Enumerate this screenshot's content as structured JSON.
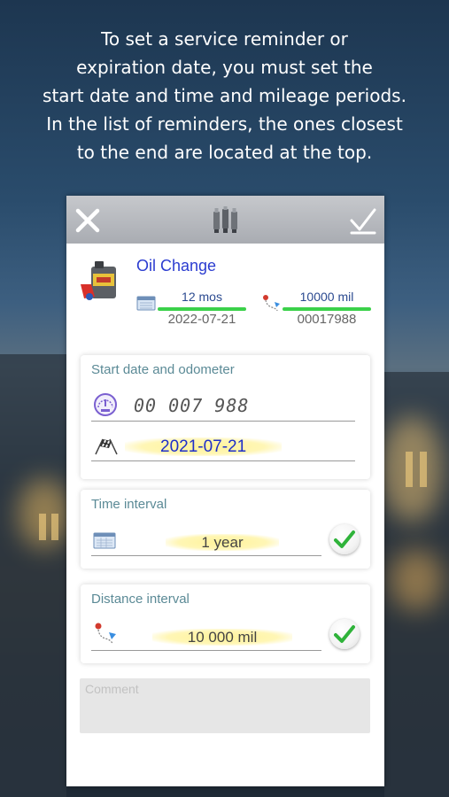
{
  "headline": {
    "line1": "To set a service reminder or",
    "line2": "expiration date, you must set the",
    "line3": "start date and time and mileage periods.",
    "line4": "In the list of reminders, the ones closest",
    "line5": "to the end are located at the top."
  },
  "toolbar": {
    "close_icon": "close-icon",
    "center_icon": "spark-plugs-icon",
    "ok_icon": "checkmark-icon"
  },
  "reminder": {
    "title": "Oil Change",
    "time_interval_short": "12 mos",
    "expiry_date": "2022-07-21",
    "distance_interval_short": "10000 mil",
    "expiry_odometer": "00017988"
  },
  "start_card": {
    "label": "Start date and odometer",
    "odometer": "00 007 988",
    "date": "2021-07-21"
  },
  "time_card": {
    "label": "Time interval",
    "value": "1 year",
    "enabled": true
  },
  "distance_card": {
    "label": "Distance interval",
    "value": "10 000 mil",
    "enabled": true
  },
  "comment": {
    "placeholder": "Comment"
  },
  "colors": {
    "accent_blue": "#1e2fc9",
    "progress_green": "#3bd14a",
    "check_green": "#2fb33a",
    "label_teal": "#5b8a96"
  }
}
